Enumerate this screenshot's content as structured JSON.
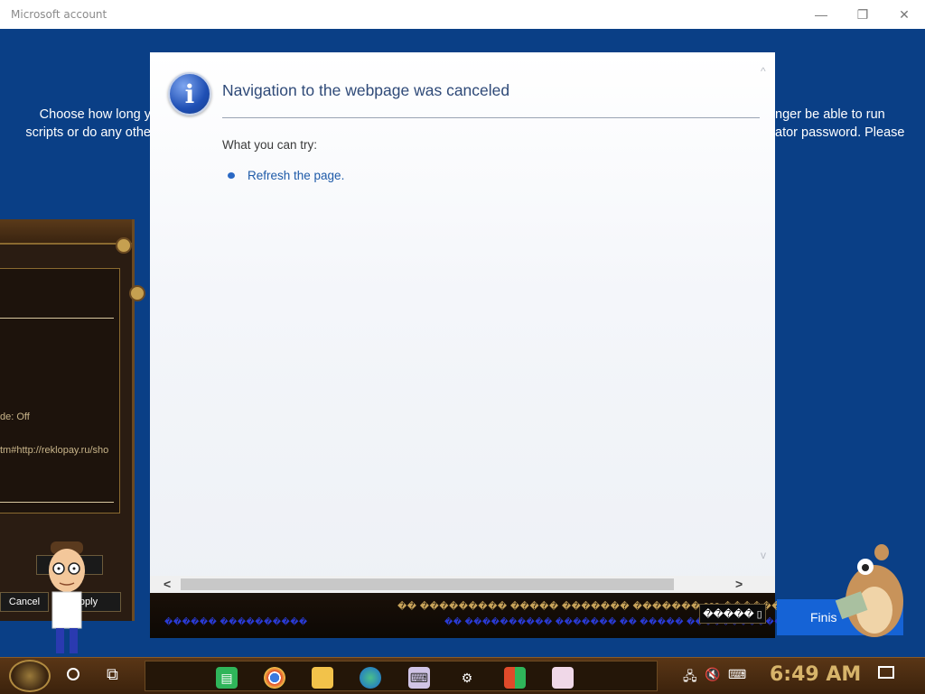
{
  "window": {
    "title": "Microsoft account",
    "minimize_glyph": "—",
    "maximize_glyph": "❐",
    "close_glyph": "✕"
  },
  "background": {
    "left_text_line1": "Choose how long y",
    "left_text_line2": "scripts or do any othe",
    "right_text_line1": "nger be able to run",
    "right_text_line2": "ator password. Please"
  },
  "steampunk_dialog": {
    "mode_text": "de: Off",
    "url_text": "tm#http://reklopay.ru/sho",
    "cancel_label": "Cancel",
    "apply_label": "pply",
    "extra_button_label": "s"
  },
  "error_dialog": {
    "icon": "info-icon",
    "title": "Navigation to the webpage was canceled",
    "what_you_can_try": "What you can try:",
    "refresh_link": "Refresh the page.",
    "scroll_left": "<",
    "scroll_right": ">",
    "scroll_up": "^",
    "scroll_down": "v"
  },
  "dark_strip": {
    "garbled_line1": "�� ��������� ����� ������� ������� 999 �������",
    "garbled_line2": "�� ���������� ������� �� ����� �����������",
    "garbled_line3": "������ ����������",
    "button_label": "����� ▯"
  },
  "finish_button": {
    "label": "Finis"
  },
  "taskbar": {
    "clock": "6:49 AM",
    "apps": [
      {
        "name": "notes-app-icon",
        "color": "#2fb55a"
      },
      {
        "name": "chrome-icon",
        "color": "#e6a420"
      },
      {
        "name": "file-explorer-icon",
        "color": "#f2c24a"
      },
      {
        "name": "edge-icon",
        "color": "#2a8ad4"
      },
      {
        "name": "keyboard-app-icon",
        "color": "#c8b8e8"
      },
      {
        "name": "settings-icon",
        "color": "#ffffff"
      },
      {
        "name": "store-icon",
        "color": "#e04a2a"
      },
      {
        "name": "window-app-icon",
        "color": "#f0d8e8"
      }
    ]
  }
}
